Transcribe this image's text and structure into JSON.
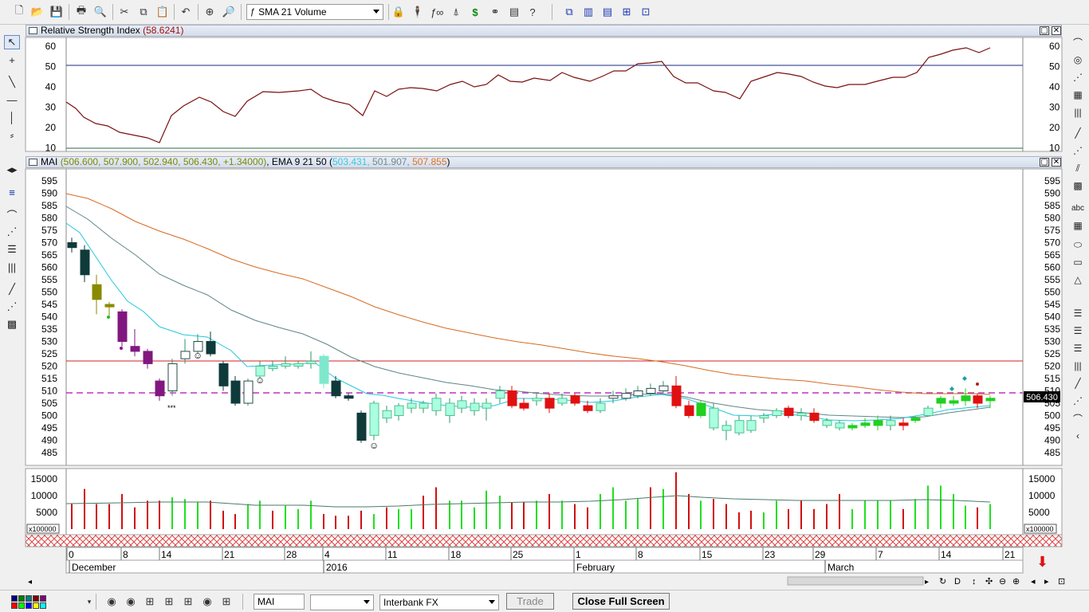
{
  "toolbar": {
    "indicator_select": "SMA 21 Volume",
    "tools": [
      "new-file",
      "open-folder",
      "save",
      "print",
      "print-preview",
      "cut",
      "copy",
      "paste",
      "undo",
      "crosshair",
      "zoom",
      "indicator",
      "tool-a",
      "tool-b",
      "function",
      "tool-c",
      "dollar",
      "binoculars",
      "tool-d",
      "help",
      "layout-a",
      "layout-b",
      "layout-c",
      "layout-d",
      "layout-e"
    ]
  },
  "rsi_panel": {
    "title": "Relative Strength Index",
    "value": "(58.6241)",
    "y_ticks": [
      "60",
      "50",
      "40",
      "30",
      "20",
      "10"
    ]
  },
  "price_panel": {
    "title_symbol": "MAI",
    "ohlc": "(506.600, 507.900, 502.940, 506.430, +1.34000)",
    "ema_label": "EMA 9 21 50",
    "ema_open": "(",
    "ema1": "503.431,",
    "ema2": "501.907,",
    "ema3": "507.855",
    "ema_close": ")",
    "ema_colors": {
      "ema9": "#33ccdd",
      "ema21": "#6a8a8a",
      "ema50": "#e07020"
    },
    "last_price": "506.430",
    "y_ticks": [
      "595",
      "590",
      "585",
      "580",
      "575",
      "570",
      "565",
      "560",
      "555",
      "550",
      "545",
      "540",
      "535",
      "530",
      "525",
      "520",
      "515",
      "510",
      "505",
      "500",
      "495",
      "490",
      "485"
    ],
    "smileys": [
      "☺",
      "☺",
      "☺"
    ],
    "stars": "***"
  },
  "volume_panel": {
    "y_ticks": [
      "15000",
      "10000",
      "5000"
    ],
    "multiplier": "x100000"
  },
  "date_axis": {
    "days": [
      "0",
      "8",
      "14",
      "21",
      "28",
      "4",
      "11",
      "18",
      "25",
      "1",
      "8",
      "15",
      "23",
      "29",
      "7",
      "14",
      "21"
    ],
    "months": [
      "December",
      "2016",
      "February",
      "March"
    ]
  },
  "bottom": {
    "symbol_input": "MAI",
    "exchange": "",
    "feed": "Interbank FX",
    "trade": "Trade",
    "close_full_screen": "Close Full Screen",
    "palette": [
      "#000080",
      "#008000",
      "#008080",
      "#800000",
      "#800080",
      "#ff0000",
      "#00ff00",
      "#0000ff",
      "#ffff00",
      "#00ffff"
    ]
  }
}
